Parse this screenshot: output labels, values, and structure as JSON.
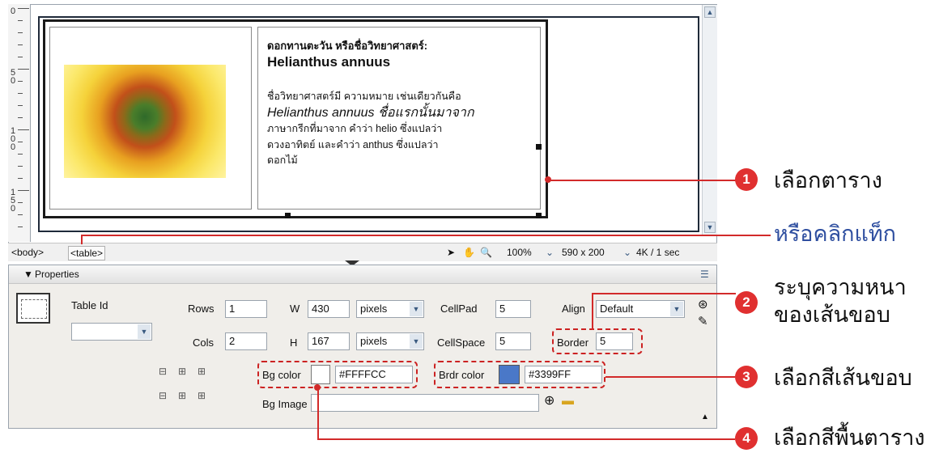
{
  "cell": {
    "title": "ดอกทานตะวัน หรือชื่อวิทยาศาสตร์:",
    "subtitle": "Helianthus annuus",
    "body_lines": [
      "ชื่อวิทยาศาสตร์มี ความหมาย เช่นเดียวกันคือ",
      "Helianthus annuus ชื่อแรกนั้นมาจาก",
      "ภาษากรีกที่มาจาก คำว่า helio ซึ่งแปลว่า",
      "ดวงอาทิตย์ และคำว่า anthus ซึ่งแปลว่า",
      "ดอกไม้"
    ]
  },
  "ruler": {
    "labels": [
      "0",
      "50",
      "100",
      "150"
    ]
  },
  "status_bar": {
    "tags": [
      "<body>",
      "<table>"
    ],
    "zoom": "100%",
    "size": "590 x 200",
    "download": "4K / 1 sec"
  },
  "properties": {
    "header": "Properties",
    "table_id_label": "Table Id",
    "rows_label": "Rows",
    "rows_value": "1",
    "cols_label": "Cols",
    "cols_value": "2",
    "w_label": "W",
    "w_value": "430",
    "w_unit": "pixels",
    "h_label": "H",
    "h_value": "167",
    "h_unit": "pixels",
    "cellpad_label": "CellPad",
    "cellpad_value": "5",
    "cellspace_label": "CellSpace",
    "cellspace_value": "5",
    "align_label": "Align",
    "align_value": "Default",
    "border_label": "Border",
    "border_value": "5",
    "bgcolor_label": "Bg color",
    "bgcolor_value": "#FFFFCC",
    "brdrcolor_label": "Brdr color",
    "brdrcolor_value": "#3399FF",
    "bgimage_label": "Bg Image"
  },
  "annotations": [
    {
      "num": "1",
      "text": "เลือกตาราง"
    },
    {
      "num": "",
      "text": "หรือคลิกแท็ก"
    },
    {
      "num": "2",
      "text": "ระบุความหนา"
    },
    {
      "num": "",
      "text": "ของเส้นขอบ"
    },
    {
      "num": "3",
      "text": "เลือกสีเส้นขอบ"
    },
    {
      "num": "4",
      "text": "เลือกสีพื้นตาราง"
    }
  ],
  "colors": {
    "accent": "#d22a2a",
    "border_color": "#3399FF",
    "bg_color": "#FFFFCC"
  }
}
